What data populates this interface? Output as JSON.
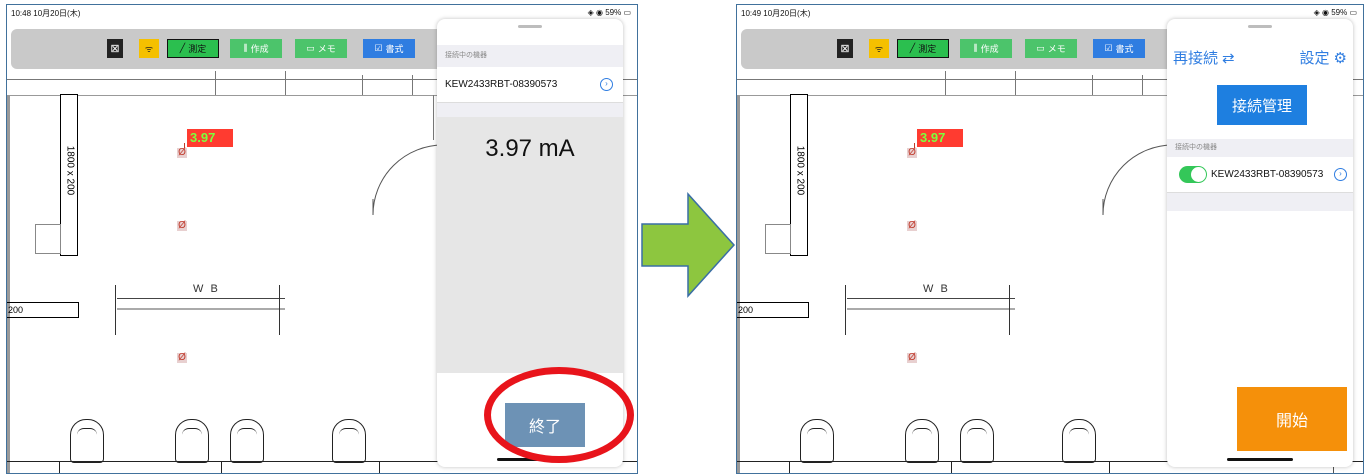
{
  "left": {
    "status": {
      "time": "10:48  10月20日(木)",
      "right": "59%"
    },
    "toolbar": {
      "close": "⊠",
      "wifi": "ᯤ",
      "measure": "測定",
      "create": "作成",
      "memo": "メモ",
      "format": "書式"
    },
    "floor": {
      "dim_label": "1800 x 200",
      "wb_label": "W B",
      "left_label": "200",
      "tag_value": "3.97"
    },
    "panel": {
      "connected_header": "接続中の機器",
      "device": "KEW2433RBT-08390573",
      "reading": "3.97 mA",
      "end_button": "終了"
    }
  },
  "right": {
    "status": {
      "time": "10:49  10月20日(木)",
      "right": "59%"
    },
    "toolbar": {
      "close": "⊠",
      "wifi": "ᯤ",
      "measure": "測定",
      "create": "作成",
      "memo": "メモ",
      "format": "書式"
    },
    "floor": {
      "dim_label": "1800 x 200",
      "wb_label": "W B",
      "left_label": "200",
      "tag_value": "3.97"
    },
    "panel": {
      "reconnect": "再接続",
      "settings": "設定",
      "manage_button": "接続管理",
      "connected_header": "接続中の機器",
      "device": "KEW2433RBT-08390573",
      "start_button": "開始"
    }
  },
  "colors": {
    "arrow": "#8dc63f",
    "highlight": "#e8141b",
    "end_button": "#6d92b5",
    "start_button": "#f5900a",
    "accent": "#2f7de1"
  }
}
